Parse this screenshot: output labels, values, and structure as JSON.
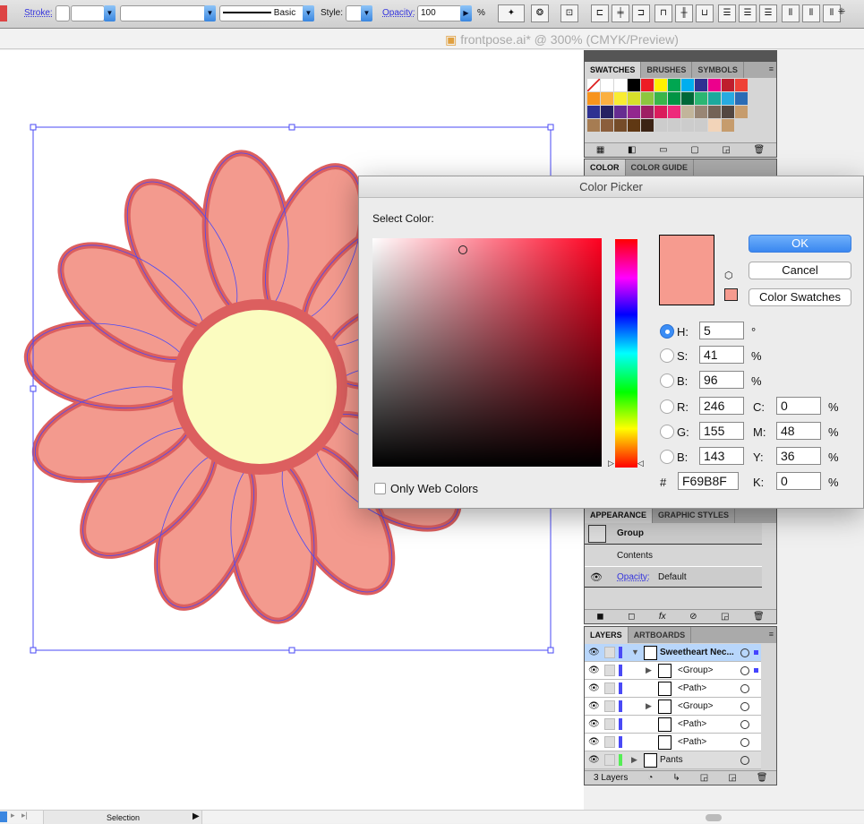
{
  "toolbar": {
    "stroke_label": "Stroke:",
    "brush_label": "Basic",
    "style_label": "Style:",
    "opacity_label": "Opacity:",
    "opacity_value": "100",
    "percent": "%"
  },
  "document": {
    "title": "frontpose.ai* @ 300% (CMYK/Preview)"
  },
  "swatches_panel": {
    "tabs": [
      "SWATCHES",
      "BRUSHES",
      "SYMBOLS"
    ],
    "colors": [
      "#ffffff",
      "#ffffff",
      "#ffffff",
      "#000000",
      "#ed1c24",
      "#fff200",
      "#00a651",
      "#00aeef",
      "#2e3192",
      "#ec008c",
      "#be1e2d",
      "#ef4136",
      "#f7941d",
      "#fbb040",
      "#f9ed32",
      "#d7e02a",
      "#8dc63f",
      "#39b54a",
      "#009444",
      "#006838",
      "#2bb673",
      "#1ba99d",
      "#27aae1",
      "#2b6cb5",
      "#2e3192",
      "#262262",
      "#662d91",
      "#92278f",
      "#9e1f63",
      "#da1c5c",
      "#ee2a7b",
      "#c2b59b",
      "#998675",
      "#736357",
      "#534741",
      "#c69c6d",
      "#a67c52",
      "#8b5e3c",
      "#754c29",
      "#603813",
      "#3c2415",
      "#cccccc",
      "#cccccc",
      "#cccccc",
      "#cccccc",
      "#f2d4b9",
      "#c69c6d",
      "#d6d6d6"
    ]
  },
  "color_panel": {
    "tabs": [
      "COLOR",
      "COLOR GUIDE"
    ]
  },
  "appearance_panel": {
    "tabs": [
      "APPEARANCE",
      "GRAPHIC STYLES"
    ],
    "group": "Group",
    "contents": "Contents",
    "opacity_label": "Opacity:",
    "opacity_value": "Default"
  },
  "layers_panel": {
    "tabs": [
      "LAYERS",
      "ARTBOARDS"
    ],
    "count": "3 Layers",
    "items": [
      {
        "name": "Sweetheart Nec...",
        "level": 0
      },
      {
        "name": "<Group>",
        "level": 1
      },
      {
        "name": "<Path>",
        "level": 1
      },
      {
        "name": "<Group>",
        "level": 1
      },
      {
        "name": "<Path>",
        "level": 1
      },
      {
        "name": "<Path>",
        "level": 1
      },
      {
        "name": "Pants",
        "level": 0
      }
    ]
  },
  "color_picker": {
    "title": "Color Picker",
    "select_label": "Select Color:",
    "ok": "OK",
    "cancel": "Cancel",
    "swatches": "Color Swatches",
    "web_only": "Only Web Colors",
    "current_color": "#F69B8F",
    "h": {
      "label": "H:",
      "value": "5",
      "unit": "°"
    },
    "s": {
      "label": "S:",
      "value": "41",
      "unit": "%"
    },
    "bv": {
      "label": "B:",
      "value": "96",
      "unit": "%"
    },
    "r": {
      "label": "R:",
      "value": "246"
    },
    "g": {
      "label": "G:",
      "value": "155"
    },
    "b": {
      "label": "B:",
      "value": "143"
    },
    "c": {
      "label": "C:",
      "value": "0",
      "unit": "%"
    },
    "m": {
      "label": "M:",
      "value": "48",
      "unit": "%"
    },
    "y": {
      "label": "Y:",
      "value": "36",
      "unit": "%"
    },
    "k": {
      "label": "K:",
      "value": "0",
      "unit": "%"
    },
    "hex_label": "#",
    "hex": "F69B8F"
  },
  "status": {
    "tool": "Selection"
  }
}
